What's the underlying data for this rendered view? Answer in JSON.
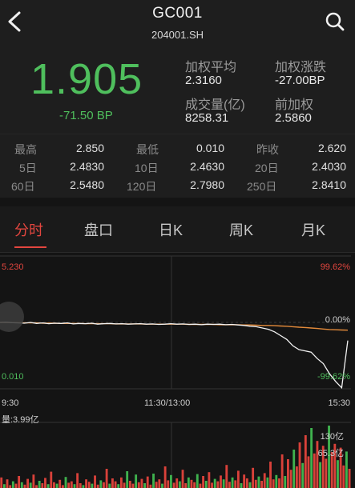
{
  "header": {
    "title": "GC001",
    "subtitle": "204001.SH",
    "back_icon": "chevron-left-icon",
    "search_icon": "search-icon"
  },
  "quote": {
    "price": "1.905",
    "change": "-71.50 BP",
    "stats": [
      {
        "label": "加权平均",
        "value": "2.3160"
      },
      {
        "label": "加权涨跌",
        "value": "-27.00BP"
      },
      {
        "label": "成交量(亿)",
        "value": "8258.31"
      },
      {
        "label": "前加权",
        "value": "2.5860"
      }
    ]
  },
  "range": {
    "rows": [
      [
        {
          "label": "最高",
          "value": "2.850"
        },
        {
          "label": "最低",
          "value": "0.010"
        },
        {
          "label": "昨收",
          "value": "2.620"
        }
      ],
      [
        {
          "label": "5日",
          "value": "2.4830"
        },
        {
          "label": "10日",
          "value": "2.4630"
        },
        {
          "label": "20日",
          "value": "2.4030"
        }
      ],
      [
        {
          "label": "60日",
          "value": "2.5480"
        },
        {
          "label": "120日",
          "value": "2.7980"
        },
        {
          "label": "250日",
          "value": "2.8410"
        }
      ]
    ]
  },
  "tabs": [
    {
      "label": "分时",
      "active": true
    },
    {
      "label": "盘口",
      "active": false
    },
    {
      "label": "日K",
      "active": false
    },
    {
      "label": "周K",
      "active": false
    },
    {
      "label": "月K",
      "active": false
    }
  ],
  "chart_data": {
    "type": "line",
    "y_left_top": "5.230",
    "y_left_bottom": "0.010",
    "y_right_top": "99.62%",
    "y_right_mid": "0.00%",
    "y_right_bottom": "-99.62%",
    "x_labels": [
      "9:30",
      "11:30/13:00",
      "15:30"
    ],
    "ylim": [
      0.01,
      5.23
    ],
    "prev_close": 2.62,
    "price_series": [
      2.62,
      2.63,
      2.61,
      2.6,
      2.59,
      2.62,
      2.58,
      2.6,
      2.57,
      2.59,
      2.58,
      2.6,
      2.56,
      2.58,
      2.57,
      2.59,
      2.55,
      2.57,
      2.58,
      2.56,
      2.57,
      2.55,
      2.56,
      2.57,
      2.55,
      2.56,
      2.54,
      2.55,
      2.57,
      2.55,
      2.56,
      2.54,
      2.55,
      2.53,
      2.55,
      2.54,
      2.55,
      2.53,
      2.54,
      2.52,
      2.5,
      2.47,
      2.45,
      2.4,
      2.35,
      2.25,
      2.1,
      1.95,
      1.7,
      1.55,
      1.5,
      1.45,
      1.2,
      1.0,
      0.6,
      0.3,
      0.05,
      1.905
    ],
    "avg_series": [
      2.62,
      2.62,
      2.61,
      2.61,
      2.6,
      2.6,
      2.6,
      2.59,
      2.59,
      2.59,
      2.58,
      2.58,
      2.58,
      2.58,
      2.57,
      2.57,
      2.57,
      2.57,
      2.57,
      2.56,
      2.56,
      2.56,
      2.56,
      2.56,
      2.55,
      2.55,
      2.55,
      2.55,
      2.55,
      2.55,
      2.55,
      2.54,
      2.54,
      2.54,
      2.54,
      2.54,
      2.53,
      2.53,
      2.53,
      2.53,
      2.52,
      2.52,
      2.51,
      2.5,
      2.5,
      2.49,
      2.48,
      2.47,
      2.45,
      2.43,
      2.42,
      2.4,
      2.38,
      2.36,
      2.34,
      2.33,
      2.32,
      2.316
    ],
    "volume_label": "量:3.99亿",
    "volume_axis": [
      "130亿",
      "65.3亿"
    ],
    "volume_max": 130,
    "volume_series": [
      22,
      8,
      18,
      6,
      14,
      9,
      25,
      12,
      7,
      19,
      11,
      28,
      6,
      15,
      10,
      21,
      8,
      34,
      12,
      9,
      17,
      6,
      23,
      11,
      14,
      8,
      31,
      10,
      6,
      18,
      13,
      9,
      26,
      7,
      16,
      12,
      40,
      9,
      20,
      14,
      8,
      22,
      11,
      35,
      15,
      9,
      28,
      12,
      19,
      10,
      24,
      7,
      30,
      13,
      18,
      9,
      45,
      16,
      27,
      11,
      20,
      14,
      38,
      10,
      22,
      17,
      12,
      29,
      9,
      25,
      15,
      33,
      11,
      19,
      14,
      26,
      18,
      48,
      13,
      22,
      16,
      36,
      10,
      28,
      20,
      12,
      42,
      17,
      24,
      15,
      31,
      22,
      55,
      18,
      27,
      20,
      70,
      25,
      60,
      38,
      80,
      45,
      95,
      52,
      110,
      66,
      125,
      72,
      98,
      54,
      88,
      61,
      130,
      75,
      92,
      58,
      84,
      47,
      76,
      40
    ]
  }
}
